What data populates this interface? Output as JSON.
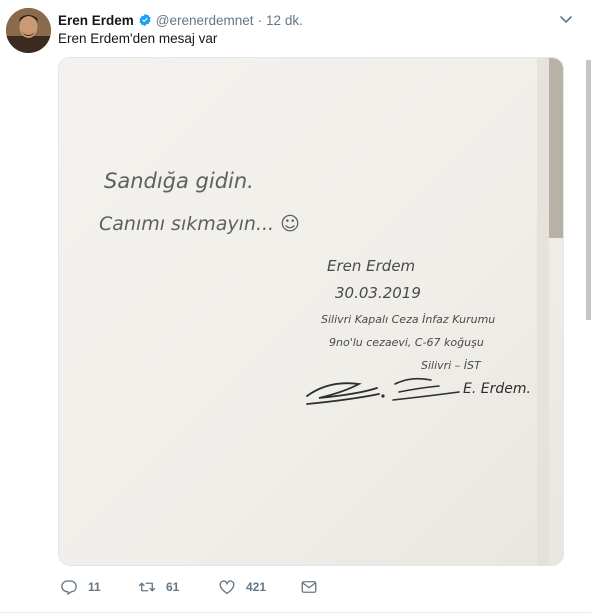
{
  "author": {
    "name": "Eren Erdem",
    "handle": "@erenerdemnet",
    "separator": "·",
    "time": "12 dk.",
    "verified": true,
    "avatar_icon": "profile-photo"
  },
  "tweet": {
    "text": "Eren Erdem'den mesaj var"
  },
  "media": {
    "note_lines": [
      "Sandığa gidin.",
      "Canımı sıkmayın... ☺"
    ],
    "signature_block": [
      "Eren Erdem",
      "30.03.2019",
      "Silivri Kapalı Ceza İnfaz Kurumu",
      "9no'lu cezaevi, C-67 koğuşu",
      "Silivri – İST"
    ],
    "signature_scrawl": "E. Erdem."
  },
  "actions": {
    "reply_count": "11",
    "retweet_count": "61",
    "like_count": "421",
    "icons": [
      "reply-icon",
      "retweet-icon",
      "like-icon",
      "direct-message-icon"
    ]
  },
  "colors": {
    "text": "#14171a",
    "muted": "#657786",
    "verified": "#1da1f2",
    "border": "#e1e8ed",
    "paper": "#f1efea",
    "ink": "#3a3a3a"
  }
}
